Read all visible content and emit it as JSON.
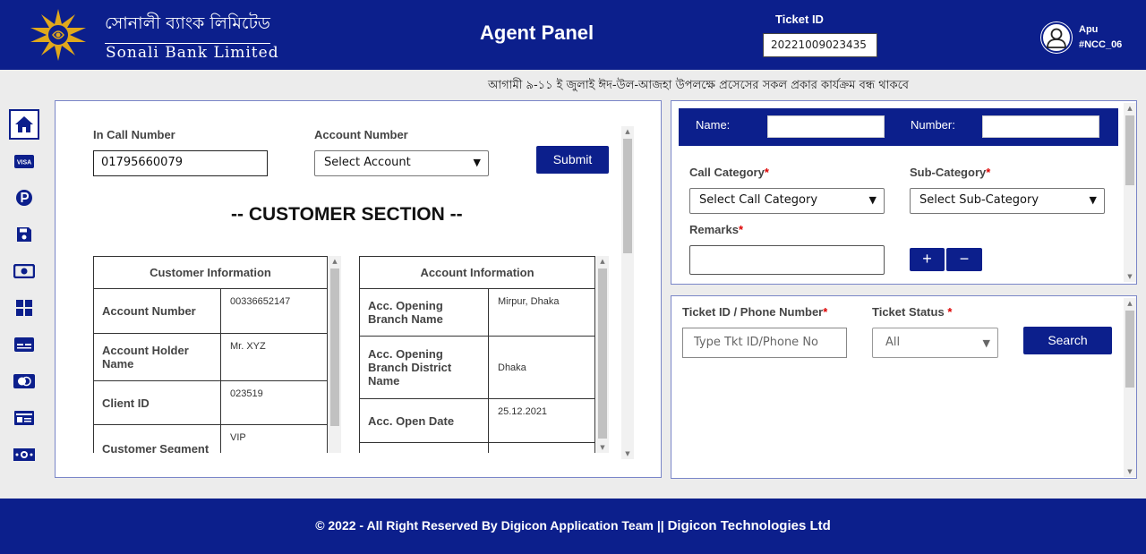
{
  "header": {
    "brand_bn": "সোনালী ব্যাংক লিমিটেড",
    "brand_en": "Sonali Bank Limited",
    "panel_title": "Agent Panel",
    "ticket_label": "Ticket ID",
    "ticket_value": "20221009023435",
    "user_name": "Apu",
    "user_code": "#NCC_06",
    "color_primary": "#0c1f8c",
    "logo_color": "#e0a81c"
  },
  "notice": "আগামী ৯-১১ ই জুলাই ঈদ-উল-আজহা উপলক্ষে প্রসেসের সকল প্রকার কার্যক্রম বন্ধ থাকবে",
  "sidebar": {
    "items": [
      "home-icon",
      "visa-icon",
      "parking-icon",
      "save-icon",
      "cash-icon",
      "grid-icon",
      "card-icon",
      "mastercard-icon",
      "id-card-icon",
      "money-icon"
    ],
    "visa_text": "VISA"
  },
  "call_form": {
    "in_call_label": "In Call Number",
    "in_call_value": "01795660079",
    "account_label": "Account Number",
    "account_select": "Select Account",
    "submit": "Submit"
  },
  "customer_section_title": "-- CUSTOMER SECTION --",
  "customer_info": {
    "header": "Customer Information",
    "rows": [
      {
        "key": "Account Number",
        "value": "00336652147"
      },
      {
        "key": "Account Holder Name",
        "value": "Mr. XYZ"
      },
      {
        "key": "Client ID",
        "value": "023519"
      },
      {
        "key": "Customer Segment",
        "value": "VIP"
      }
    ]
  },
  "account_info": {
    "header": "Account Information",
    "rows": [
      {
        "key": "Acc. Opening Branch Name",
        "value": "Mirpur, Dhaka"
      },
      {
        "key": "Acc. Opening Branch District Name",
        "value": "Dhaka"
      },
      {
        "key": "Acc. Open Date",
        "value": "25.12.2021"
      }
    ]
  },
  "ticket_form": {
    "name_label": "Name:",
    "number_label": "Number:",
    "call_category_label": "Call Category",
    "call_category_select": "Select Call Category",
    "sub_category_label": "Sub-Category",
    "sub_category_select": "Select Sub-Category",
    "remarks_label": "Remarks",
    "required_mark": "*",
    "plus": "+",
    "minus": "−"
  },
  "search_form": {
    "ticket_phone_label": "Ticket ID / Phone Number",
    "ticket_phone_placeholder": "Type Tkt ID/Phone No",
    "status_label": "Ticket Status",
    "status_select": "All",
    "search": "Search"
  },
  "footer": {
    "left": "© 2022 - All Right Reserved By Digicon Application Team ||",
    "right": "Digicon Technologies Ltd"
  }
}
